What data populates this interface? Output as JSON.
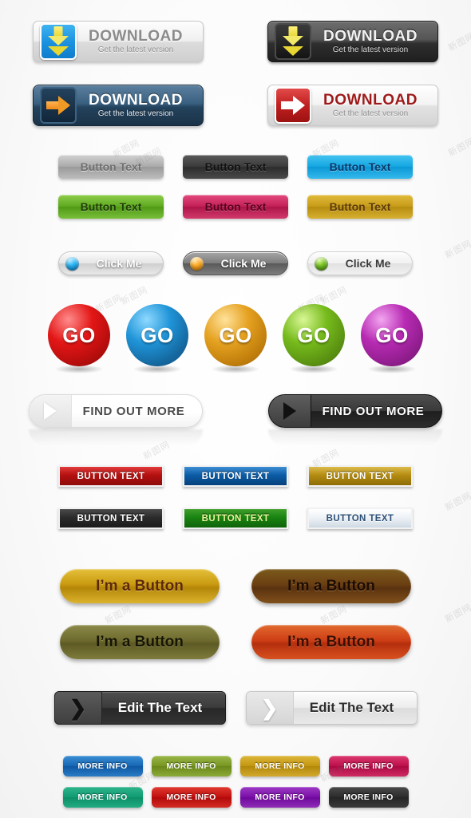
{
  "page": {
    "title": "Web Button Set",
    "background": "#fbfbfb",
    "watermark": "新图网"
  },
  "sections": [
    {
      "id": "download-buttons",
      "buttons": [
        {
          "id": "download-grey",
          "title": "DOWNLOAD",
          "subtitle": "Get the latest version",
          "icon": "download-arrow-icon",
          "accent": "#1d93e2",
          "style": "grey"
        },
        {
          "id": "download-dark",
          "title": "DOWNLOAD",
          "subtitle": "Get the latest version",
          "icon": "download-arrow-icon",
          "accent": "#e8d733",
          "style": "dark"
        },
        {
          "id": "download-blue",
          "title": "DOWNLOAD",
          "subtitle": "Get the latest version",
          "icon": "right-arrow-icon",
          "accent": "#f09a26",
          "style": "blue"
        },
        {
          "id": "download-red",
          "title": "DOWNLOAD",
          "subtitle": "Get the latest version",
          "icon": "right-arrow-icon",
          "accent": "#c01f1f",
          "style": "red"
        }
      ]
    },
    {
      "id": "button-text-pills",
      "buttons": [
        {
          "id": "button-text-grey",
          "label": "Button Text",
          "color": "#a9a9a9"
        },
        {
          "id": "button-text-dark",
          "label": "Button Text",
          "color": "#3a3a3a"
        },
        {
          "id": "button-text-blue",
          "label": "Button Text",
          "color": "#13a6e2"
        },
        {
          "id": "button-text-green",
          "label": "Button Text",
          "color": "#5ca81d"
        },
        {
          "id": "button-text-pink",
          "label": "Button Text",
          "color": "#c21f54"
        },
        {
          "id": "button-text-gold",
          "label": "Button Text",
          "color": "#c59a17"
        }
      ]
    },
    {
      "id": "click-me-buttons",
      "buttons": [
        {
          "id": "click-me-blue",
          "label": "Click Me",
          "dot_color": "#27b4f5",
          "style": "light"
        },
        {
          "id": "click-me-orange",
          "label": "Click Me",
          "dot_color": "#ffac23",
          "style": "dark"
        },
        {
          "id": "click-me-green",
          "label": "Click Me",
          "dot_color": "#78c423",
          "style": "plain"
        }
      ]
    },
    {
      "id": "go-spheres",
      "buttons": [
        {
          "id": "go-red",
          "label": "GO",
          "color": "#e31616"
        },
        {
          "id": "go-blue",
          "label": "GO",
          "color": "#1f94d8"
        },
        {
          "id": "go-orange",
          "label": "GO",
          "color": "#e5a120"
        },
        {
          "id": "go-green",
          "label": "GO",
          "color": "#76bb1c"
        },
        {
          "id": "go-purple",
          "label": "GO",
          "color": "#b72bb3"
        }
      ]
    },
    {
      "id": "find-out-more-buttons",
      "buttons": [
        {
          "id": "find-out-more-light",
          "label": "FIND OUT MORE",
          "icon": "play-triangle-icon",
          "style": "light"
        },
        {
          "id": "find-out-more-dark",
          "label": "FIND OUT MORE",
          "icon": "play-triangle-icon",
          "style": "dark"
        }
      ]
    },
    {
      "id": "button-text-rectangles",
      "buttons": [
        {
          "id": "rect-button-red",
          "label": "BUTTON TEXT",
          "color": "#b41010"
        },
        {
          "id": "rect-button-blue",
          "label": "BUTTON TEXT",
          "color": "#0b5ba5"
        },
        {
          "id": "rect-button-gold",
          "label": "BUTTON TEXT",
          "color": "#b48c12"
        },
        {
          "id": "rect-button-black",
          "label": "BUTTON TEXT",
          "color": "#2b2b2b"
        },
        {
          "id": "rect-button-green",
          "label": "BUTTON TEXT",
          "color": "#198412"
        },
        {
          "id": "rect-button-white",
          "label": "BUTTON TEXT",
          "color": "#eef2f6"
        }
      ]
    },
    {
      "id": "im-a-button-pills",
      "buttons": [
        {
          "id": "im-a-button-gold",
          "label": "I’m a Button",
          "color": "#c99a10"
        },
        {
          "id": "im-a-button-brown",
          "label": "I’m a Button",
          "color": "#6b3f12"
        },
        {
          "id": "im-a-button-olive",
          "label": "I’m a Button",
          "color": "#6e6b2e"
        },
        {
          "id": "im-a-button-rust",
          "label": "I’m a Button",
          "color": "#cf3e16"
        }
      ]
    },
    {
      "id": "edit-the-text-buttons",
      "buttons": [
        {
          "id": "edit-the-text-dark",
          "label": "Edit The Text",
          "icon": "chevron-right-icon",
          "style": "dark"
        },
        {
          "id": "edit-the-text-light",
          "label": "Edit The Text",
          "icon": "chevron-right-icon",
          "style": "light"
        }
      ]
    },
    {
      "id": "more-info-buttons",
      "buttons": [
        {
          "id": "more-info-blue",
          "label": "MORE INFO",
          "color": "#1565b3"
        },
        {
          "id": "more-info-green",
          "label": "MORE INFO",
          "color": "#77951f"
        },
        {
          "id": "more-info-gold",
          "label": "MORE INFO",
          "color": "#c2960f"
        },
        {
          "id": "more-info-pink",
          "label": "MORE INFO",
          "color": "#bc0e4a"
        },
        {
          "id": "more-info-teal",
          "label": "MORE INFO",
          "color": "#109b73"
        },
        {
          "id": "more-info-red",
          "label": "MORE INFO",
          "color": "#c00f0f"
        },
        {
          "id": "more-info-purple",
          "label": "MORE INFO",
          "color": "#7a0ea8"
        },
        {
          "id": "more-info-black",
          "label": "MORE INFO",
          "color": "#2b2b2b"
        }
      ]
    }
  ]
}
